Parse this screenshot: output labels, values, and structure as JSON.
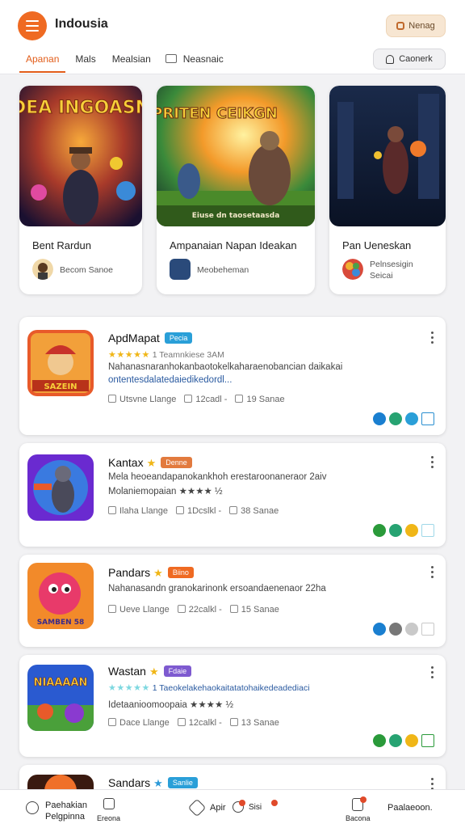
{
  "header": {
    "title": "Indousia",
    "top_button": "Nenag",
    "tabs": [
      "Apanan",
      "Mals",
      "Mealsian",
      "Neasnaic"
    ],
    "profile_button": "Caonerk"
  },
  "featured": [
    {
      "art_title": "DEA INGOASN",
      "art_subtitle": "",
      "title": "Bent Rardun",
      "subtitle": "Becom Sanoe"
    },
    {
      "art_title": "PRITEN CEIKGN",
      "art_subtitle": "Eiuse dn taosetaasda",
      "title": "Ampanaian Napan Ideakan",
      "subtitle": "Meobeheman"
    },
    {
      "art_title": "",
      "art_subtitle": "",
      "title": "Pan Ueneskan",
      "subtitle": "Pelnsesigin Seicai"
    }
  ],
  "games": [
    {
      "name": "ApdMapat",
      "badge": "Pecia",
      "badge_color": "#2a9fd8",
      "star_after_name": "",
      "rating_text": "1 Teamnkiese 3AM",
      "desc1": "Nahanasnaranhokanbaotokelkaharaenobancian daikakai",
      "desc2": "ontentesdalatedaiedikedordl...",
      "stat1": "Utsvne Llange",
      "stat2": "12cadl -",
      "stat3": "19 Sanae",
      "icon_art": "SAZEIN",
      "action_colors": [
        "#1a7fd0",
        "#27a372",
        "#2a9fd8",
        "#2a8fd0"
      ]
    },
    {
      "name": "Kantax",
      "badge": "Denne",
      "badge_color": "#e27a3e",
      "star_after_name": "★",
      "rating_text": "",
      "desc1": "Mela heoeandapanokankhoh erestaroonaneraor 2aiv",
      "desc2": "Molaniemopaian ★★★★ ½",
      "stat1": "Ilaha Llange",
      "stat2": "1Dcslkl -",
      "stat3": "38 Sanae",
      "icon_art": "",
      "action_colors": [
        "#2a9a3a",
        "#27a372",
        "#f0b617",
        "#9fd8e8"
      ]
    },
    {
      "name": "Pandars",
      "badge": "Biino",
      "badge_color": "#ef6a22",
      "star_after_name": "★",
      "rating_text": "",
      "desc1": "Nahanasandn granokarinonk ersoandaenenaor 22ha",
      "desc2": "",
      "stat1": "Ueve Llange",
      "stat2": "22calkl -",
      "stat3": "15 Sanae",
      "icon_art": "SAMBEN 58",
      "action_colors": [
        "#1a7fd0",
        "#777777",
        "#c9c9c9",
        "#c9c9c9"
      ]
    },
    {
      "name": "Wastan",
      "badge": "Fdaie",
      "badge_color": "#7e5ad0",
      "star_after_name": "★",
      "rating_text": "1 Taeokelakehaokaitatatohaikedeadediaci",
      "desc1": "Idetaanioomoopaia ★★★★ ½",
      "desc2": "",
      "stat1": "Dace Llange",
      "stat2": "12calkl -",
      "stat3": "13 Sanae",
      "icon_art": "NIAAAAN",
      "action_colors": [
        "#2a9a3a",
        "#27a372",
        "#f0b617",
        "#2a9a3a"
      ]
    },
    {
      "name": "Sandars",
      "badge": "Sanlie",
      "badge_color": "#2a9fd8",
      "star_after_name": "★",
      "rating_text": "",
      "desc1": "",
      "desc2": "",
      "stat1": "",
      "stat2": "",
      "stat3": "",
      "icon_art": "",
      "action_colors": []
    }
  ],
  "bottom_nav": {
    "item1_line1": "Paehakian",
    "item1_line2": "Pelgpinna",
    "item2": "Ereona",
    "item3": "Apir",
    "item3_extra": "Sisi",
    "item4": "Bacona",
    "item5": "Paalaeoon."
  }
}
